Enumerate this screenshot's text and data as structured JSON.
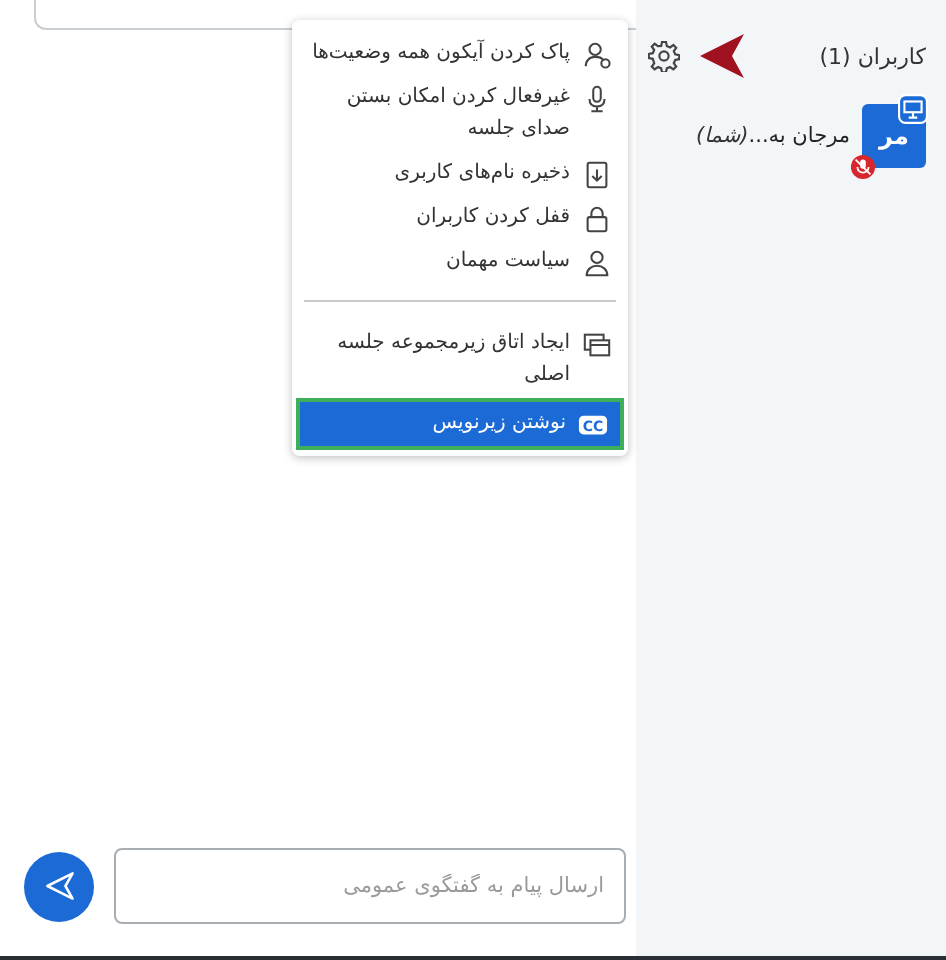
{
  "users_panel": {
    "title": "کاربران (1)",
    "users": [
      {
        "avatar_text": "مر",
        "name": "مرجان به...",
        "suffix": "(شما)",
        "muted": true,
        "presenter": true
      }
    ]
  },
  "options_menu": {
    "groups": [
      [
        {
          "label": "پاک کردن آیکون همه وضعیت‌ها",
          "selected": false
        },
        {
          "label": "غیرفعال کردن امکان بستن صدای جلسه",
          "selected": false
        },
        {
          "label": "ذخیره نام‌های کاربری",
          "selected": false
        },
        {
          "label": "قفل کردن کاربران",
          "selected": false
        },
        {
          "label": "سیاست مهمان",
          "selected": false
        }
      ],
      [
        {
          "label": "ایجاد اتاق زیرمجموعه جلسه اصلی",
          "selected": false
        },
        {
          "label": "نوشتن زیرنویس",
          "selected": true,
          "badge": "CC"
        }
      ]
    ]
  },
  "chat": {
    "placeholder": "ارسال پیام به گفتگوی عمومی"
  }
}
